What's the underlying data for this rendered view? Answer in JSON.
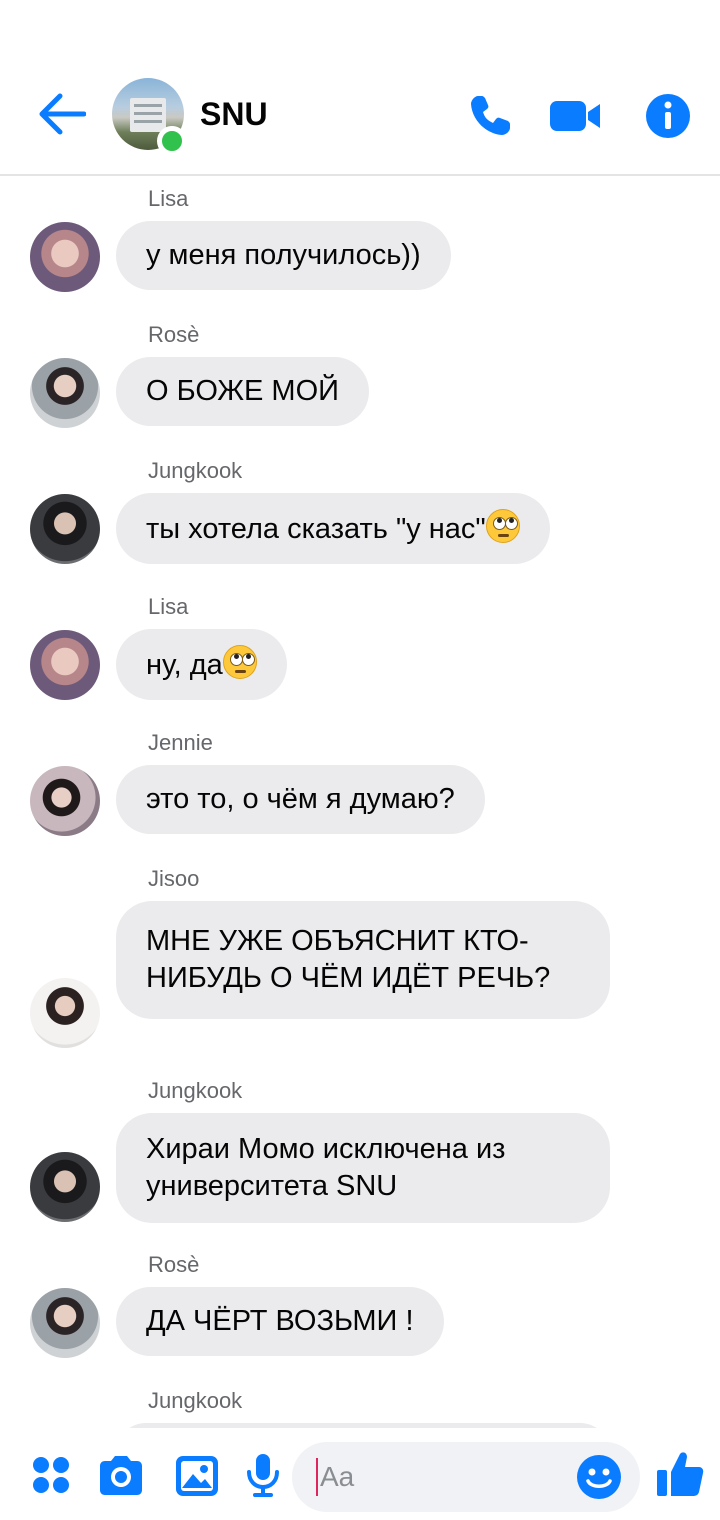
{
  "header": {
    "title": "SNU",
    "icons": [
      "back-arrow-icon",
      "phone-icon",
      "video-camera-icon",
      "info-icon"
    ],
    "accent_color": "#0a7cff",
    "online_color": "#31c24d"
  },
  "messages": [
    {
      "sender": "Lisa",
      "text": "у меня получилось))"
    },
    {
      "sender": "Rosè",
      "text": "О БОЖЕ МОЙ"
    },
    {
      "sender": "Jungkook",
      "text": "ты хотела сказать \"у нас\"",
      "emoji": "face-with-rolling-eyes"
    },
    {
      "sender": "Lisa",
      "text": "ну, да",
      "emoji": "face-with-rolling-eyes"
    },
    {
      "sender": "Jennie",
      "text": "это то, о чём я думаю?"
    },
    {
      "sender": "Jisoo",
      "text": "МНЕ УЖЕ ОБЪЯСНИТ КТО-НИБУДЬ О ЧЁМ ИДЁТ РЕЧЬ?"
    },
    {
      "sender": "Jungkook",
      "text": "Хираи Момо исключена из университета SNU"
    },
    {
      "sender": "Rosè",
      "text": "ДА ЧЁРТ ВОЗЬМИ !"
    },
    {
      "sender": "Jungkook",
      "text": ""
    }
  ],
  "composer": {
    "placeholder": "Aa",
    "icons": [
      "apps-grid-icon",
      "camera-icon",
      "gallery-icon",
      "microphone-icon",
      "emoji-icon",
      "thumbs-up-icon"
    ]
  },
  "colors": {
    "bubble": "#ebebed",
    "sender_text": "#65676b"
  }
}
